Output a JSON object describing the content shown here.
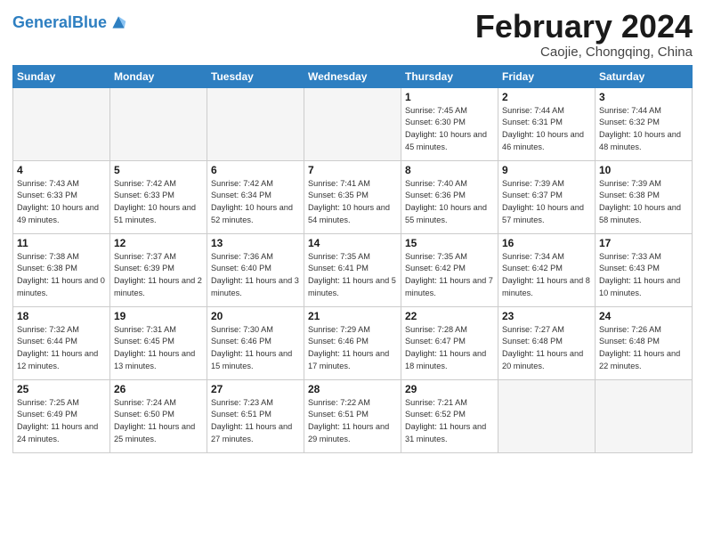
{
  "header": {
    "logo_general": "General",
    "logo_blue": "Blue",
    "title": "February 2024",
    "location": "Caojie, Chongqing, China"
  },
  "calendar": {
    "days_of_week": [
      "Sunday",
      "Monday",
      "Tuesday",
      "Wednesday",
      "Thursday",
      "Friday",
      "Saturday"
    ],
    "weeks": [
      [
        {
          "day": "",
          "empty": true
        },
        {
          "day": "",
          "empty": true
        },
        {
          "day": "",
          "empty": true
        },
        {
          "day": "",
          "empty": true
        },
        {
          "day": "1",
          "sunrise": "7:45 AM",
          "sunset": "6:30 PM",
          "daylight": "10 hours and 45 minutes."
        },
        {
          "day": "2",
          "sunrise": "7:44 AM",
          "sunset": "6:31 PM",
          "daylight": "10 hours and 46 minutes."
        },
        {
          "day": "3",
          "sunrise": "7:44 AM",
          "sunset": "6:32 PM",
          "daylight": "10 hours and 48 minutes."
        }
      ],
      [
        {
          "day": "4",
          "sunrise": "7:43 AM",
          "sunset": "6:33 PM",
          "daylight": "10 hours and 49 minutes."
        },
        {
          "day": "5",
          "sunrise": "7:42 AM",
          "sunset": "6:33 PM",
          "daylight": "10 hours and 51 minutes."
        },
        {
          "day": "6",
          "sunrise": "7:42 AM",
          "sunset": "6:34 PM",
          "daylight": "10 hours and 52 minutes."
        },
        {
          "day": "7",
          "sunrise": "7:41 AM",
          "sunset": "6:35 PM",
          "daylight": "10 hours and 54 minutes."
        },
        {
          "day": "8",
          "sunrise": "7:40 AM",
          "sunset": "6:36 PM",
          "daylight": "10 hours and 55 minutes."
        },
        {
          "day": "9",
          "sunrise": "7:39 AM",
          "sunset": "6:37 PM",
          "daylight": "10 hours and 57 minutes."
        },
        {
          "day": "10",
          "sunrise": "7:39 AM",
          "sunset": "6:38 PM",
          "daylight": "10 hours and 58 minutes."
        }
      ],
      [
        {
          "day": "11",
          "sunrise": "7:38 AM",
          "sunset": "6:38 PM",
          "daylight": "11 hours and 0 minutes."
        },
        {
          "day": "12",
          "sunrise": "7:37 AM",
          "sunset": "6:39 PM",
          "daylight": "11 hours and 2 minutes."
        },
        {
          "day": "13",
          "sunrise": "7:36 AM",
          "sunset": "6:40 PM",
          "daylight": "11 hours and 3 minutes."
        },
        {
          "day": "14",
          "sunrise": "7:35 AM",
          "sunset": "6:41 PM",
          "daylight": "11 hours and 5 minutes."
        },
        {
          "day": "15",
          "sunrise": "7:35 AM",
          "sunset": "6:42 PM",
          "daylight": "11 hours and 7 minutes."
        },
        {
          "day": "16",
          "sunrise": "7:34 AM",
          "sunset": "6:42 PM",
          "daylight": "11 hours and 8 minutes."
        },
        {
          "day": "17",
          "sunrise": "7:33 AM",
          "sunset": "6:43 PM",
          "daylight": "11 hours and 10 minutes."
        }
      ],
      [
        {
          "day": "18",
          "sunrise": "7:32 AM",
          "sunset": "6:44 PM",
          "daylight": "11 hours and 12 minutes."
        },
        {
          "day": "19",
          "sunrise": "7:31 AM",
          "sunset": "6:45 PM",
          "daylight": "11 hours and 13 minutes."
        },
        {
          "day": "20",
          "sunrise": "7:30 AM",
          "sunset": "6:46 PM",
          "daylight": "11 hours and 15 minutes."
        },
        {
          "day": "21",
          "sunrise": "7:29 AM",
          "sunset": "6:46 PM",
          "daylight": "11 hours and 17 minutes."
        },
        {
          "day": "22",
          "sunrise": "7:28 AM",
          "sunset": "6:47 PM",
          "daylight": "11 hours and 18 minutes."
        },
        {
          "day": "23",
          "sunrise": "7:27 AM",
          "sunset": "6:48 PM",
          "daylight": "11 hours and 20 minutes."
        },
        {
          "day": "24",
          "sunrise": "7:26 AM",
          "sunset": "6:48 PM",
          "daylight": "11 hours and 22 minutes."
        }
      ],
      [
        {
          "day": "25",
          "sunrise": "7:25 AM",
          "sunset": "6:49 PM",
          "daylight": "11 hours and 24 minutes."
        },
        {
          "day": "26",
          "sunrise": "7:24 AM",
          "sunset": "6:50 PM",
          "daylight": "11 hours and 25 minutes."
        },
        {
          "day": "27",
          "sunrise": "7:23 AM",
          "sunset": "6:51 PM",
          "daylight": "11 hours and 27 minutes."
        },
        {
          "day": "28",
          "sunrise": "7:22 AM",
          "sunset": "6:51 PM",
          "daylight": "11 hours and 29 minutes."
        },
        {
          "day": "29",
          "sunrise": "7:21 AM",
          "sunset": "6:52 PM",
          "daylight": "11 hours and 31 minutes."
        },
        {
          "day": "",
          "empty": true
        },
        {
          "day": "",
          "empty": true
        }
      ]
    ]
  }
}
